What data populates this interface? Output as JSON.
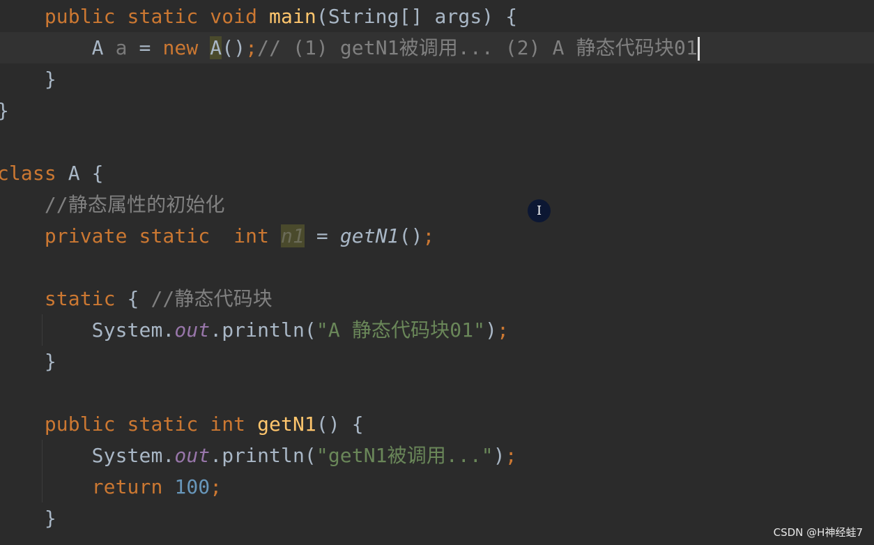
{
  "editor": {
    "lines": [
      [
        [
          "    ",
          ""
        ],
        [
          "public ",
          "kw"
        ],
        [
          "static ",
          "kw"
        ],
        [
          "void ",
          "kw"
        ],
        [
          "main",
          "fn"
        ],
        [
          "(String[] args) {",
          ""
        ]
      ],
      [
        [
          "        ",
          ""
        ],
        [
          "A ",
          ""
        ],
        [
          "a",
          "unused"
        ],
        [
          " = ",
          ""
        ],
        [
          "new ",
          "kw"
        ],
        [
          "A",
          "hl"
        ],
        [
          "()",
          ""
        ],
        [
          ";",
          "kw"
        ],
        [
          "// (1) getN1被调用... (2) A 静态代码块01",
          "cmt"
        ]
      ],
      [
        [
          "    }",
          ""
        ]
      ],
      [
        [
          "}",
          ""
        ]
      ],
      [],
      [
        [
          "class ",
          "kw"
        ],
        [
          "A {",
          ""
        ]
      ],
      [
        [
          "    ",
          ""
        ],
        [
          "//静态属性的初始化",
          "cmt"
        ]
      ],
      [
        [
          "    ",
          ""
        ],
        [
          "private ",
          "kw"
        ],
        [
          "static  ",
          "kw"
        ],
        [
          "int ",
          "kw"
        ],
        [
          "n1",
          "n1"
        ],
        [
          " = ",
          ""
        ],
        [
          "getN1",
          "ital"
        ],
        [
          "()",
          ""
        ],
        [
          ";",
          "kw"
        ]
      ],
      [],
      [
        [
          "    ",
          ""
        ],
        [
          "static ",
          "kw"
        ],
        [
          "{ ",
          ""
        ],
        [
          "//静态代码块",
          "cmt"
        ]
      ],
      [
        [
          "        System.",
          ""
        ],
        [
          "out",
          "fld"
        ],
        [
          ".println(",
          ""
        ],
        [
          "\"A 静态代码块01\"",
          "str"
        ],
        [
          ")",
          ""
        ],
        [
          ";",
          "kw"
        ]
      ],
      [
        [
          "    }",
          ""
        ]
      ],
      [],
      [
        [
          "    ",
          ""
        ],
        [
          "public ",
          "kw"
        ],
        [
          "static ",
          "kw"
        ],
        [
          "int ",
          "kw"
        ],
        [
          "getN1",
          "fn"
        ],
        [
          "() {",
          ""
        ]
      ],
      [
        [
          "        System.",
          ""
        ],
        [
          "out",
          "fld"
        ],
        [
          ".println(",
          ""
        ],
        [
          "\"getN1被调用...\"",
          "str"
        ],
        [
          ")",
          ""
        ],
        [
          ";",
          "kw"
        ]
      ],
      [
        [
          "        ",
          ""
        ],
        [
          "return ",
          "kw"
        ],
        [
          "100",
          "num"
        ],
        [
          ";",
          "kw"
        ]
      ],
      [
        [
          "    }",
          ""
        ]
      ]
    ],
    "current_line": 1,
    "cursor_icon": "text-cursor-icon",
    "cursor_glyph": "I"
  },
  "watermark": "CSDN @H神经蛙7",
  "colors": {
    "background": "#2b2b2b",
    "keyword": "#cc7832",
    "method": "#ffc66d",
    "string": "#6a8759",
    "comment": "#808080",
    "number": "#6897bb",
    "field": "#9876aa"
  }
}
